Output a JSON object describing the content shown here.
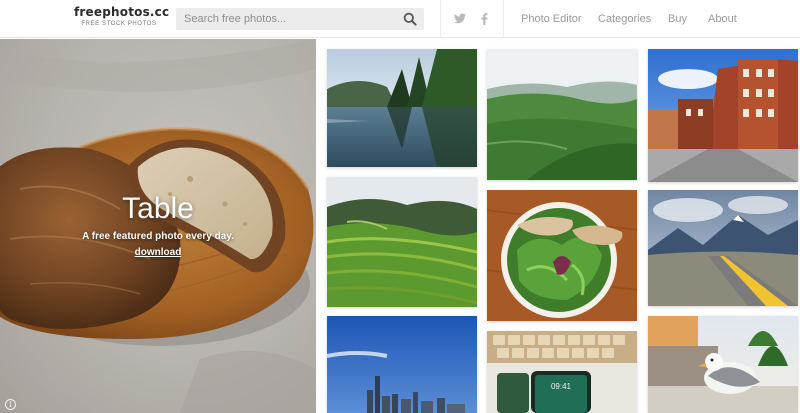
{
  "header": {
    "logo": {
      "name": "freephotos.cc",
      "tagline": "FREE STOCK PHOTOS"
    },
    "search": {
      "placeholder": "Search free photos..."
    },
    "social": [
      "twitter-icon",
      "facebook-icon"
    ],
    "nav": [
      "Photo Editor",
      "Categories",
      "Buy",
      "About"
    ]
  },
  "hero": {
    "title": "Table",
    "subtitle": "A free featured photo every day.",
    "download_label": "download",
    "info_symbol": "i"
  },
  "colors": {
    "nav_text": "#9a9a9a",
    "search_bg": "#ececec",
    "hero_cloth": "#c7c3bd",
    "board_wood": "#b5732c"
  },
  "grid": [
    "lake-with-pine-trees",
    "green-valley-hills",
    "town-street-red-brick-buildings",
    "rice-terraces-hills",
    "salad-bowl-with-bread",
    "mountain-road",
    "city-skyline-blue-sky",
    "keyboard-and-smartphone",
    "seagull-by-waterfront"
  ]
}
